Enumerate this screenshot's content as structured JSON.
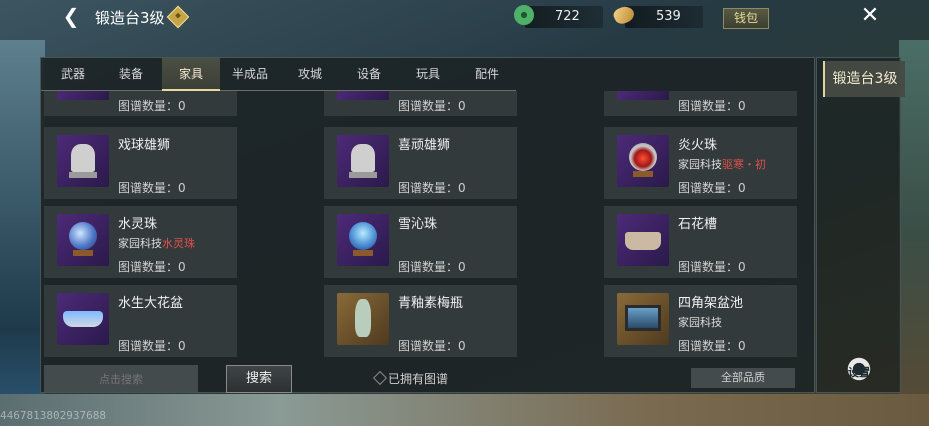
{
  "header": {
    "title": "锻造台3级",
    "currency_jade": "722",
    "currency_coin": "539",
    "wallet_label": "钱包"
  },
  "tabs": [
    {
      "label": "武器"
    },
    {
      "label": "装备"
    },
    {
      "label": "家具",
      "active": true
    },
    {
      "label": "半成品"
    },
    {
      "label": "攻城"
    },
    {
      "label": "设备"
    },
    {
      "label": "玩具"
    },
    {
      "label": "配件"
    }
  ],
  "partial_row": [
    {
      "count": "图谱数量：0"
    },
    {
      "count": "图谱数量：0"
    },
    {
      "count": "图谱数量：0"
    }
  ],
  "items": [
    {
      "name": "戏球雄狮",
      "tech": "",
      "tech_red": "",
      "count": "图谱数量：0",
      "icon": "lion"
    },
    {
      "name": "喜顽雄狮",
      "tech": "",
      "tech_red": "",
      "count": "图谱数量：0",
      "icon": "lion"
    },
    {
      "name": "炎火珠",
      "tech": "家园科技",
      "tech_red": "驱寒・初",
      "count": "图谱数量：0",
      "icon": "fire-orb"
    },
    {
      "name": "水灵珠",
      "tech": "家园科技",
      "tech_red": "水灵珠",
      "count": "图谱数量：0",
      "icon": "water-orb"
    },
    {
      "name": "雪沁珠",
      "tech": "",
      "tech_red": "",
      "count": "图谱数量：0",
      "icon": "snow-orb"
    },
    {
      "name": "石花槽",
      "tech": "",
      "tech_red": "",
      "count": "图谱数量：0",
      "icon": "stone-trough"
    },
    {
      "name": "水生大花盆",
      "tech": "",
      "tech_red": "",
      "count": "图谱数量：0",
      "icon": "flower-pot"
    },
    {
      "name": "青釉素梅瓶",
      "tech": "",
      "tech_red": "",
      "count": "图谱数量：0",
      "icon": "vase"
    },
    {
      "name": "四角架盆池",
      "tech": "家园科技",
      "tech_red": "",
      "count": "图谱数量：0",
      "icon": "basin"
    }
  ],
  "bottom": {
    "search_placeholder": "点击搜索",
    "search_button": "搜索",
    "owned_label": "已拥有图谱",
    "quality_label": "全部品质"
  },
  "side": {
    "tab_label": "锻造台3级",
    "gear_label": "设置"
  },
  "watermark": "4467813802937688"
}
